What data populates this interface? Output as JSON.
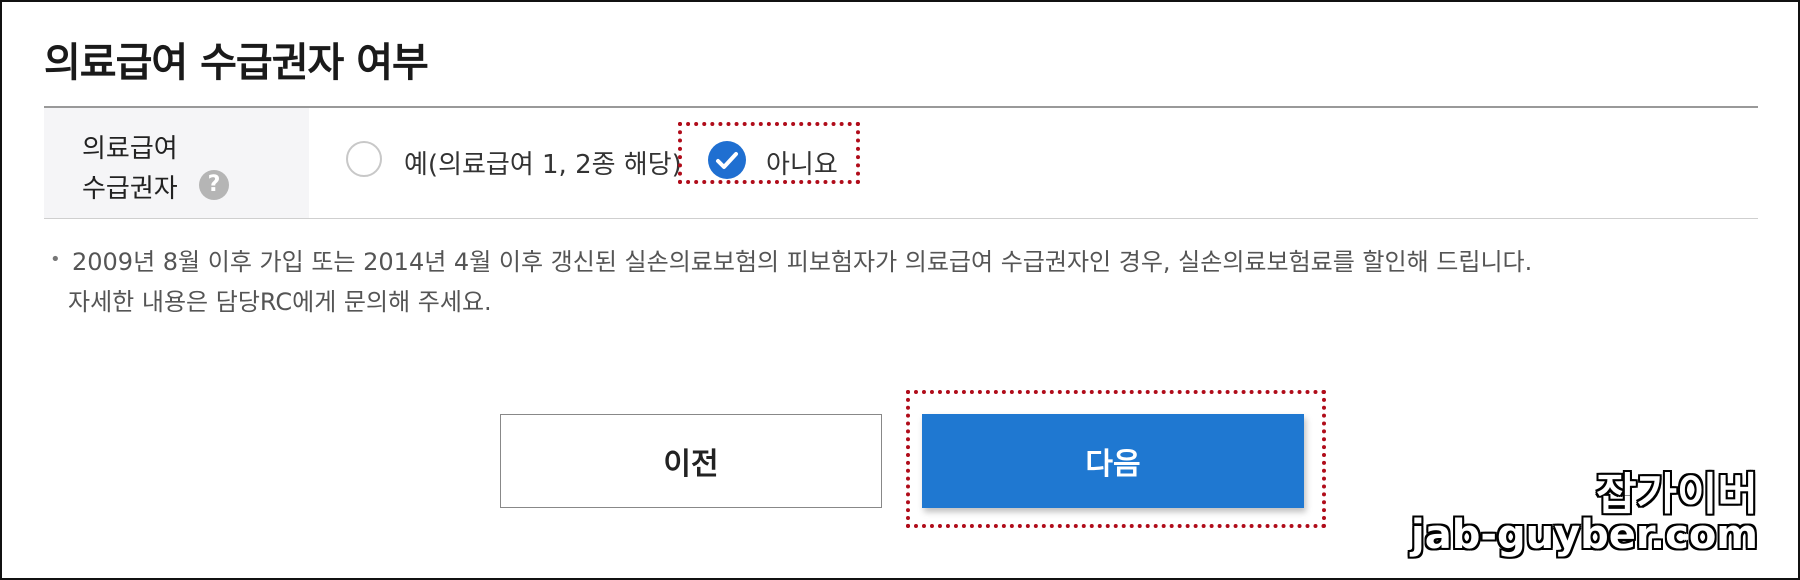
{
  "page_title": "의료급여 수급권자 여부",
  "form": {
    "label_line1": "의료급여",
    "label_line2": "수급권자",
    "help_icon_glyph": "?",
    "options": [
      {
        "label": "예(의료급여 1, 2종 해당)",
        "selected": false
      },
      {
        "label": "아니요",
        "selected": true
      }
    ]
  },
  "notice": {
    "bullet": "•",
    "line1": "2009년 8월 이후 가입 또는 2014년 4월 이후 갱신된 실손의료보험의 피보험자가 의료급여 수급권자인 경우, 실손의료보험료를 할인해 드립니다.",
    "line2": "자세한 내용은 담당RC에게 문의해 주세요."
  },
  "buttons": {
    "prev_label": "이전",
    "next_label": "다음"
  },
  "watermark": {
    "title": "잡가이버",
    "url": "jab-guyber.com"
  },
  "colors": {
    "primary": "#1f78d1",
    "checked_radio": "#1f6fd1",
    "highlight_border": "#b00c1a",
    "label_background": "#f5f5f7"
  }
}
